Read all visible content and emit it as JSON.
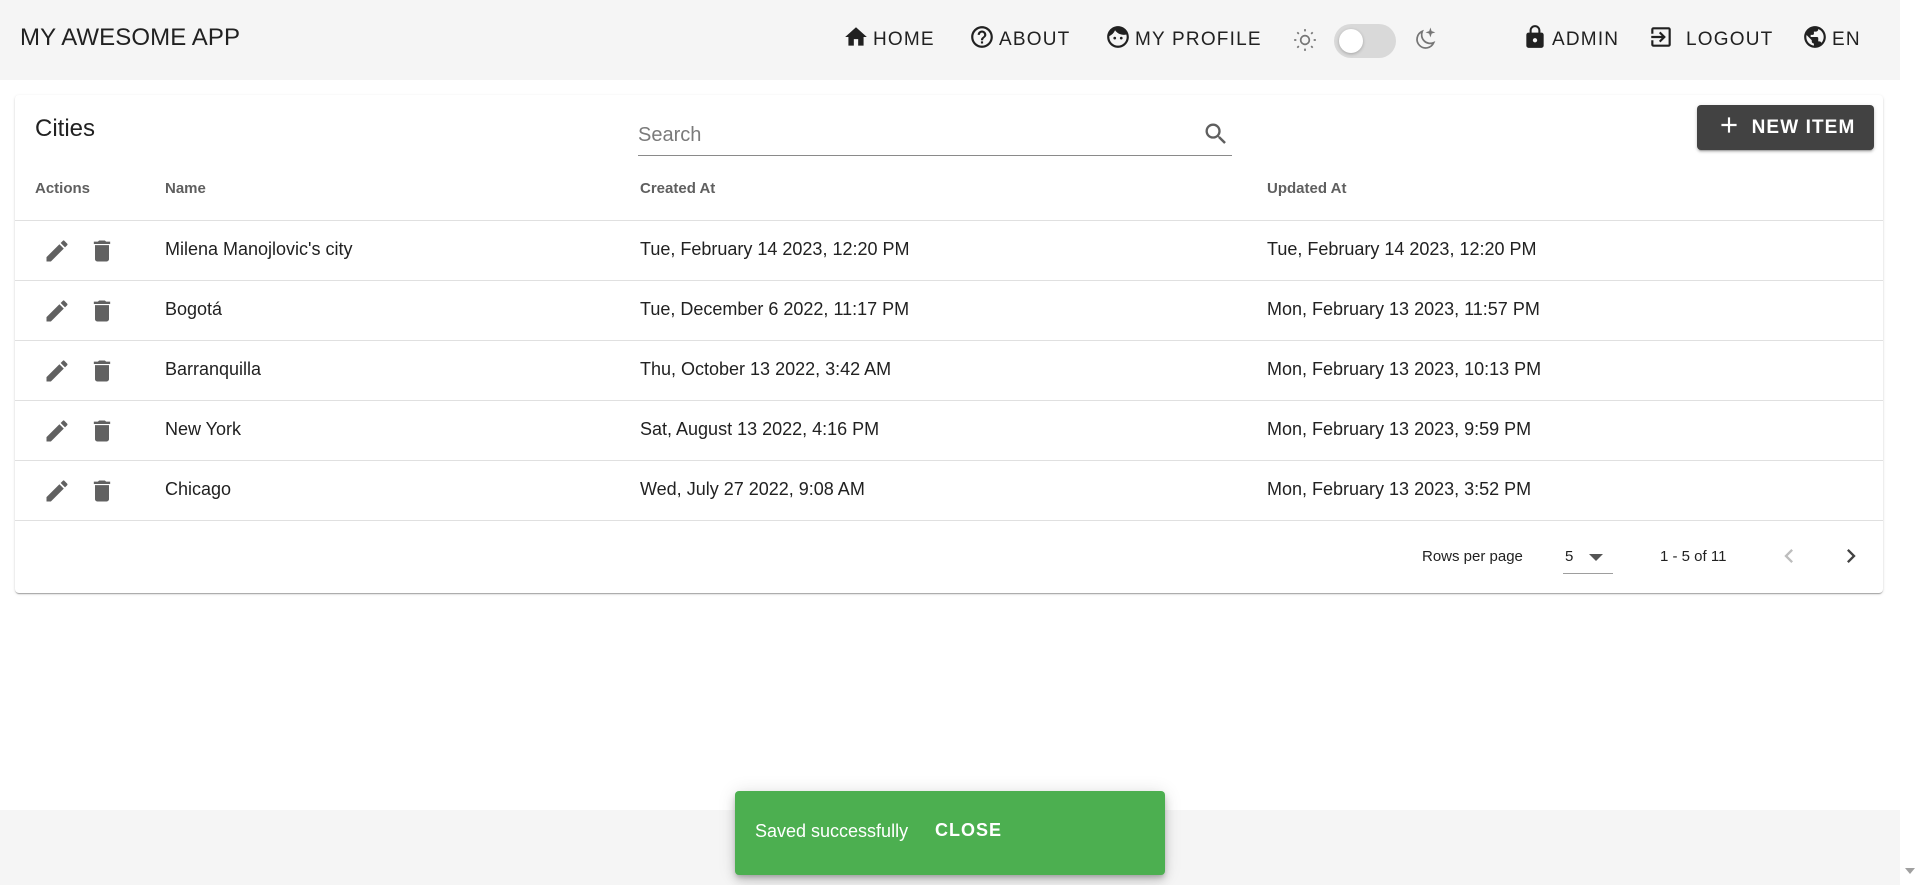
{
  "app": {
    "title": "MY AWESOME APP"
  },
  "nav": {
    "home": "HOME",
    "about": "ABOUT",
    "profile": "MY PROFILE",
    "admin": "ADMIN",
    "logout": "LOGOUT",
    "language": "EN"
  },
  "theme": {
    "dark_mode": false
  },
  "card": {
    "title": "Cities",
    "search_placeholder": "Search",
    "new_item_label": "NEW ITEM"
  },
  "table": {
    "headers": {
      "actions": "Actions",
      "name": "Name",
      "created": "Created At",
      "updated": "Updated At"
    },
    "rows": [
      {
        "name": "Milena Manojlovic's city",
        "created": "Tue, February 14 2023, 12:20 PM",
        "updated": "Tue, February 14 2023, 12:20 PM"
      },
      {
        "name": "Bogotá",
        "created": "Tue, December 6 2022, 11:17 PM",
        "updated": "Mon, February 13 2023, 11:57 PM"
      },
      {
        "name": "Barranquilla",
        "created": "Thu, October 13 2022, 3:42 AM",
        "updated": "Mon, February 13 2023, 10:13 PM"
      },
      {
        "name": "New York",
        "created": "Sat, August 13 2022, 4:16 PM",
        "updated": "Mon, February 13 2023, 9:59 PM"
      },
      {
        "name": "Chicago",
        "created": "Wed, July 27 2022, 9:08 AM",
        "updated": "Mon, February 13 2023, 3:52 PM"
      }
    ]
  },
  "pagination": {
    "rows_per_page_label": "Rows per page",
    "rows_per_page": "5",
    "range": "1 - 5 of 11"
  },
  "snackbar": {
    "message": "Saved successfully",
    "close_label": "CLOSE",
    "color": "#4caf50"
  },
  "colors": {
    "appbar_bg": "#f5f5f5",
    "primary_button": "#424242",
    "icon_gray": "#616161"
  }
}
